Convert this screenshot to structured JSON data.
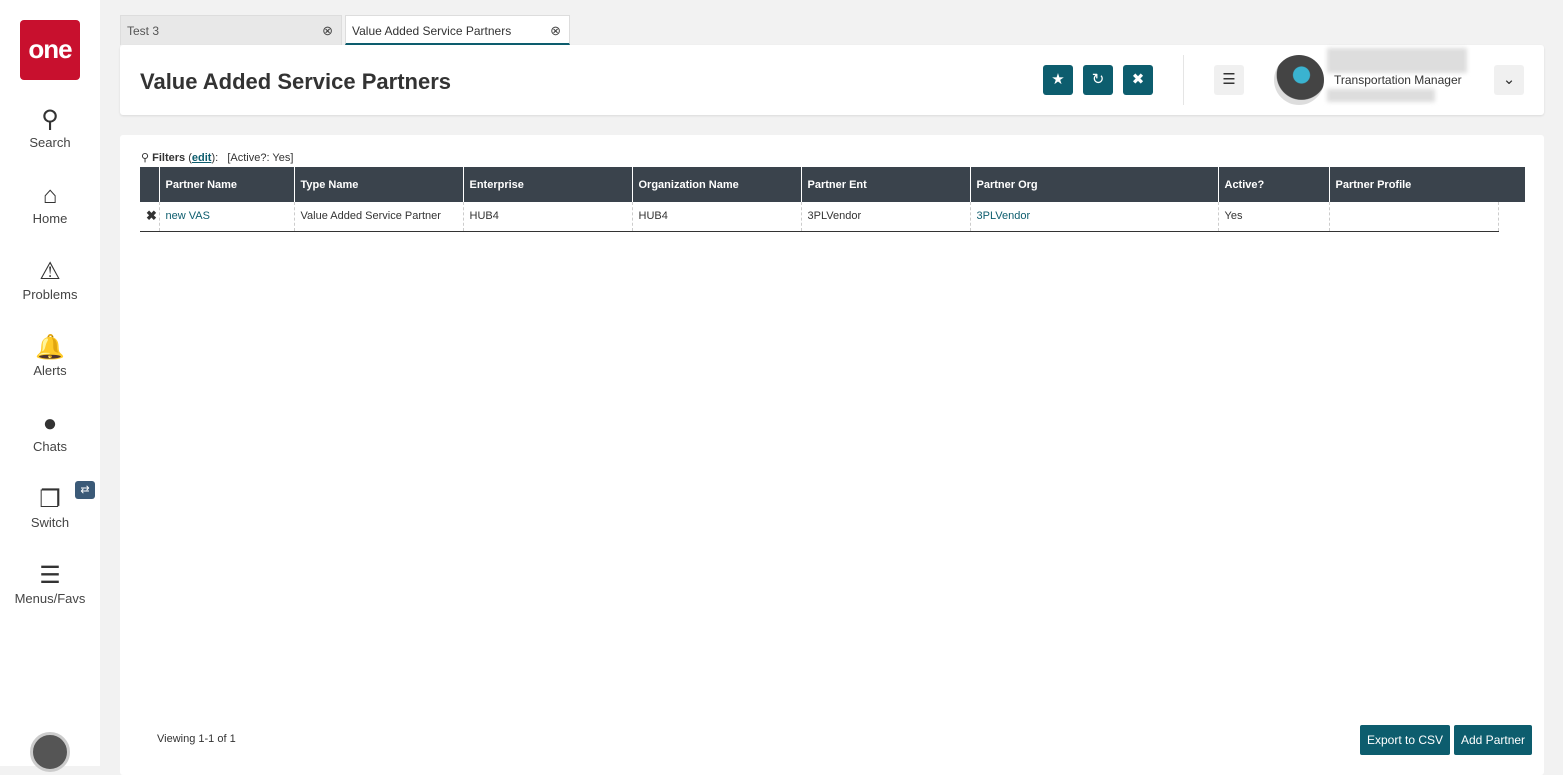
{
  "sidebar": {
    "logo": "one",
    "items": [
      {
        "label": "Search",
        "icon": "search-icon"
      },
      {
        "label": "Home",
        "icon": "home-icon"
      },
      {
        "label": "Problems",
        "icon": "warning-icon"
      },
      {
        "label": "Alerts",
        "icon": "bell-icon"
      },
      {
        "label": "Chats",
        "icon": "chat-icon"
      },
      {
        "label": "Switch",
        "icon": "switch-icon"
      },
      {
        "label": "Menus/Favs",
        "icon": "menu-icon"
      }
    ]
  },
  "tabs": [
    {
      "label": "Test 3"
    },
    {
      "label": "Value Added Service Partners"
    }
  ],
  "header": {
    "title": "Value Added Service Partners",
    "role": "Transportation Manager"
  },
  "filters": {
    "label": "Filters",
    "edit": "edit",
    "value": "[Active?: Yes]"
  },
  "table": {
    "columns": [
      "Partner Name",
      "Type Name",
      "Enterprise",
      "Organization Name",
      "Partner Ent",
      "Partner Org",
      "Active?",
      "Partner Profile"
    ],
    "rows": [
      [
        "new VAS",
        "Value Added Service Partner",
        "HUB4",
        "HUB4",
        "3PLVendor",
        "3PLVendor",
        "Yes",
        ""
      ]
    ]
  },
  "footer": {
    "viewing": "Viewing 1-1 of 1",
    "export": "Export to CSV",
    "add": "Add Partner"
  }
}
